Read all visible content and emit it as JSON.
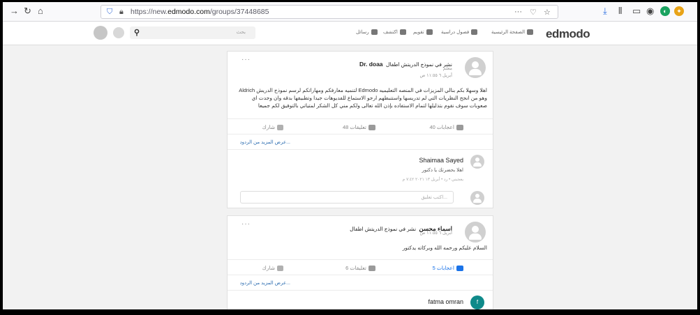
{
  "browser": {
    "url_prefix": "https://new.",
    "url_domain": "edmodo.com",
    "url_path": "/groups/37448685",
    "more_label": "···"
  },
  "nav": {
    "logo": "edmodo",
    "home": "الصفحة الرئيسية",
    "classes": "فصول دراسية",
    "calendar": "تقويم",
    "discover": "اكتشف",
    "messages": "رسائل",
    "search_placeholder": "بحث"
  },
  "posts": [
    {
      "author": "Dr. doaa",
      "action": "نشر في نموذج الدريتش اطفال",
      "role": "معلم",
      "time": "أبريل ٦ ١١:٥٥ ص",
      "body": "اهلا وسهلا بكم بنالي المزيزات في المنصه التعليميه Edmodo لتنميه معارفكم ومهاراتكم لرسم نموذج الدريش Aldrich وهو من انجح النظريات التي لم تدريسها واستنبطهم ارجو الاستماع للفديوهات جيدا وتطبيقها بدقه وان وجدت اي صعوبات سوف نقوم بتذليلها لتمام الاستفاده بإذن الله تعالى ولكم مني كل الشكر لمتياتي بالتوفيق لكم جميعا",
      "likes": "40 اعجابات",
      "comments": "48 تعليقات",
      "share": "شارك",
      "more_replies": "عرض المزيد من الردود...",
      "comment": {
        "author": "Shaimaa Sayed",
        "text": "اهلا بحضرتك يا دكتور",
        "meta": "يعجبني • رد • أبريل ١٣ ٢٠٢١ ٧:٤٢ م"
      },
      "comment_placeholder": "اكتب تعليق..."
    },
    {
      "author": "اسماء محسن",
      "action": "نشر في نموذج الدريتش اطفال",
      "time": "أبريل ٦ ١١:٥٥ ص",
      "body": "السلام عليكم ورحمه الله وبركاته يدكتور",
      "likes": "5 اعجابات",
      "comments": "6 تعليقات",
      "share": "شارك",
      "more_replies": "عرض المزيد من الردود...",
      "comment": {
        "author": "fatma omran",
        "initial": "f"
      }
    }
  ],
  "colors": {
    "like_active": "#1a73e8",
    "teal_avatar": "#0f8a8a"
  }
}
